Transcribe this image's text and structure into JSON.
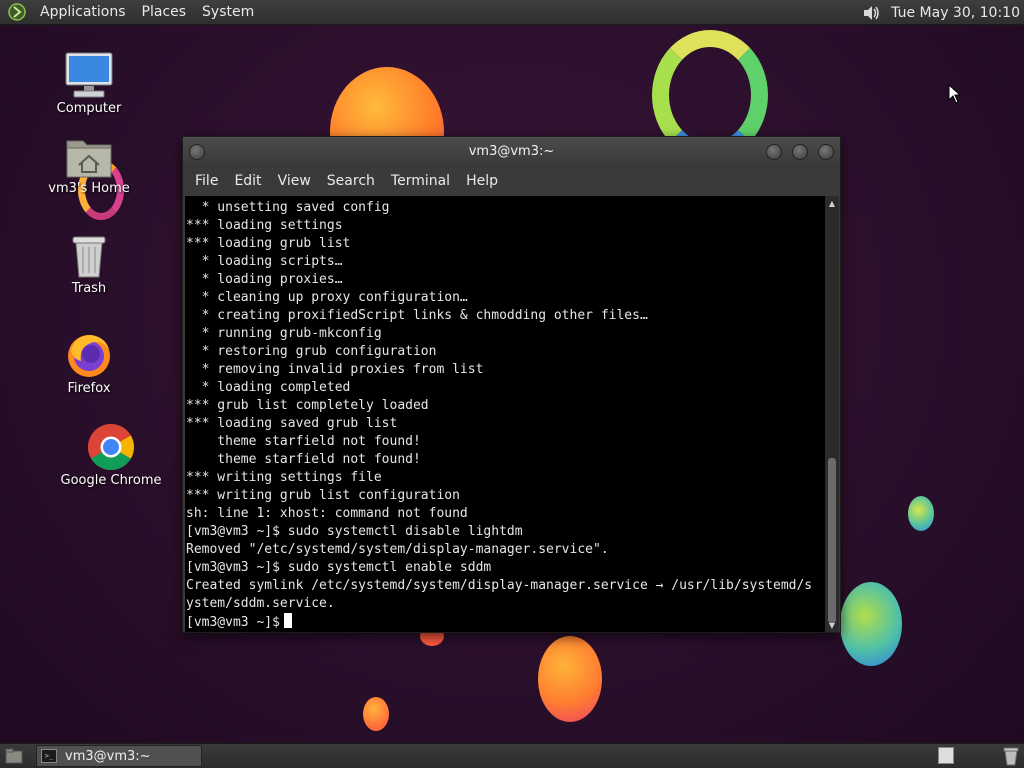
{
  "top_panel": {
    "menus": [
      "Applications",
      "Places",
      "System"
    ],
    "clock": "Tue May 30, 10:10"
  },
  "desktop_icons": [
    {
      "label": "Computer",
      "icon": "computer-icon"
    },
    {
      "label": "vm3's Home",
      "icon": "home-folder-icon"
    },
    {
      "label": "Trash",
      "icon": "trash-icon"
    },
    {
      "label": "Firefox",
      "icon": "firefox-icon"
    },
    {
      "label": "Google Chrome",
      "icon": "chrome-icon"
    }
  ],
  "terminal": {
    "title": "vm3@vm3:~",
    "menu": [
      "File",
      "Edit",
      "View",
      "Search",
      "Terminal",
      "Help"
    ],
    "lines": [
      "  * unsetting saved config",
      "*** loading settings",
      "*** loading grub list",
      "  * loading scripts…",
      "  * loading proxies…",
      "  * cleaning up proxy configuration…",
      "  * creating proxifiedScript links & chmodding other files…",
      "  * running grub-mkconfig",
      "  * restoring grub configuration",
      "  * removing invalid proxies from list",
      "  * loading completed",
      "*** grub list completely loaded",
      "*** loading saved grub list",
      "    theme starfield not found!",
      "    theme starfield not found!",
      "*** writing settings file",
      "*** writing grub list configuration",
      "sh: line 1: xhost: command not found",
      "[vm3@vm3 ~]$ sudo systemctl disable lightdm",
      "Removed \"/etc/systemd/system/display-manager.service\".",
      "[vm3@vm3 ~]$ sudo systemctl enable sddm",
      "Created symlink /etc/systemd/system/display-manager.service → /usr/lib/systemd/s",
      "ystem/sddm.service."
    ],
    "prompt": "[vm3@vm3 ~]$"
  },
  "taskbar": {
    "window_button": "vm3@vm3:~"
  }
}
